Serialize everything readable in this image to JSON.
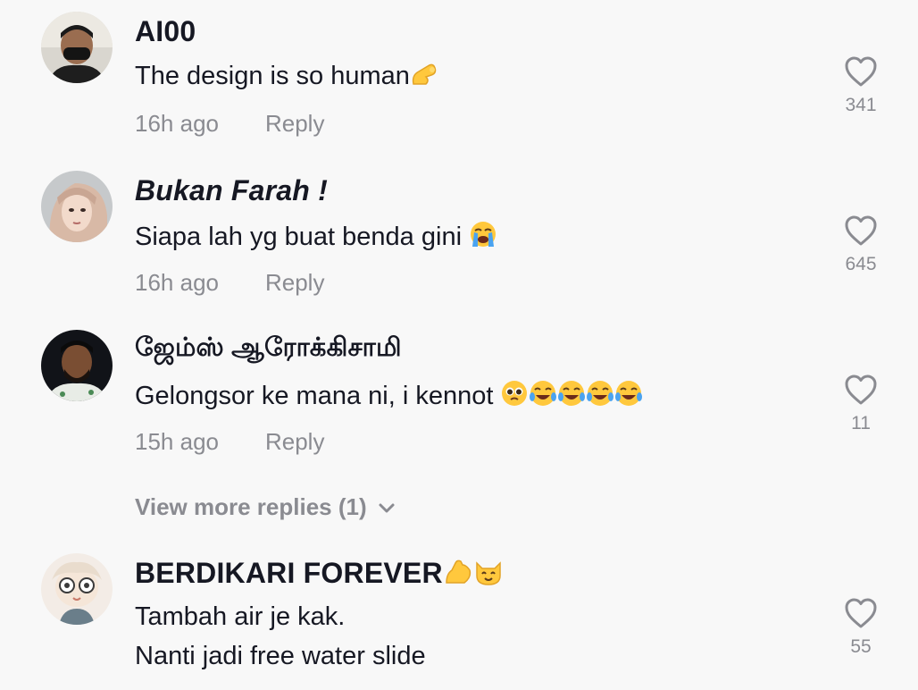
{
  "comments": [
    {
      "username": "AI00",
      "lines": [
        "The design is so human"
      ],
      "emojis": [
        "pinching-hand"
      ],
      "time": "16h ago",
      "reply_label": "Reply",
      "likes": "341"
    },
    {
      "username": "Bukan Farah",
      "username_suffix": "!",
      "lines": [
        "Siapa lah yg buat benda gini "
      ],
      "emojis": [
        "loudly-crying-face"
      ],
      "time": "16h ago",
      "reply_label": "Reply",
      "likes": "645"
    },
    {
      "username": "ஜேம்ஸ் ஆரோக்கிசாமி",
      "lines": [
        "Gelongsor ke mana ni, i kennot "
      ],
      "emojis": [
        "pleading-face",
        "tears-of-joy",
        "tears-of-joy",
        "tears-of-joy",
        "tears-of-joy"
      ],
      "time": "15h ago",
      "reply_label": "Reply",
      "likes": "11"
    },
    {
      "username": "BERDIKARI FOREVER",
      "lines": [
        "Tambah air je kak.",
        "Nanti jadi free water slide"
      ],
      "emojis": [
        "flexed-biceps",
        "cat-face"
      ],
      "likes": "55"
    }
  ],
  "view_more_replies": "View more replies (1)",
  "colors": {
    "background": "#f8f8f8",
    "text_primary": "#161823",
    "text_secondary": "#8a8b91",
    "emoji_yellow": "#ffc83d"
  }
}
